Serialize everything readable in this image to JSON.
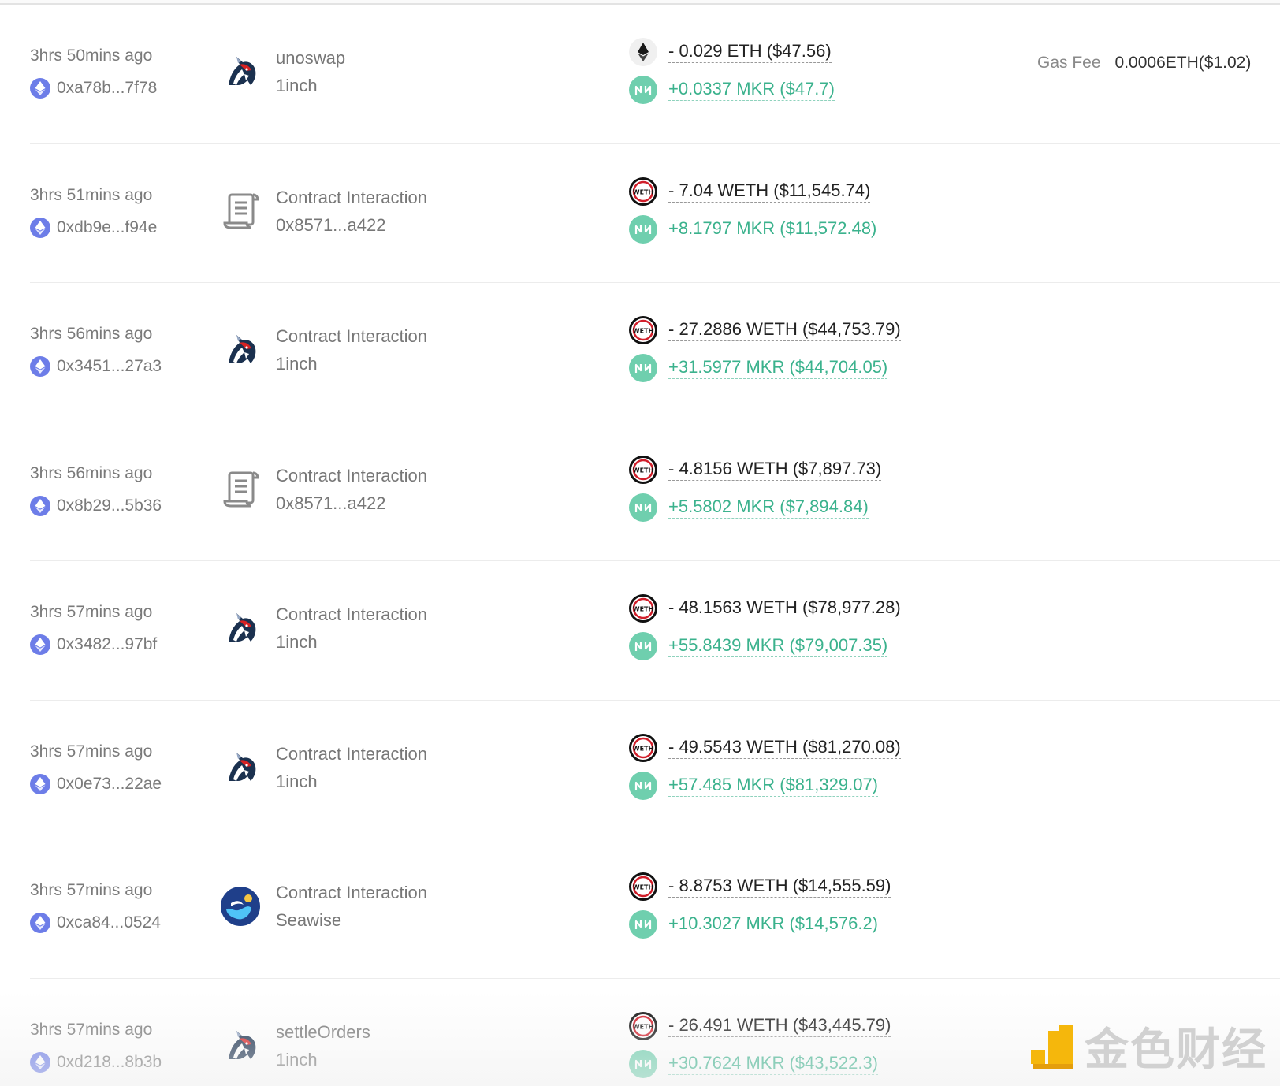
{
  "gas": {
    "label": "Gas Fee",
    "value": "0.0006ETH($1.02)"
  },
  "icons": {
    "address": "ethereum-icon",
    "oneinch": "1inch-unicorn-icon",
    "contract": "contract-scroll-icon",
    "seawise": "seawise-icon",
    "eth": "eth-token-icon",
    "weth": "weth-token-icon",
    "mkr": "mkr-token-icon"
  },
  "colors": {
    "in": "#3bb28d",
    "out": "#222222",
    "mkr": "#6fcfae",
    "eth_badge": "#6d7de8"
  },
  "rows": [
    {
      "time": "3hrs 50mins ago",
      "address": "0xa78b...7f78",
      "icon": "oneinch",
      "method": "unoswap",
      "sub": "1inch",
      "out_token": "eth",
      "out": "- 0.029 ETH ($47.56)",
      "in": "+0.0337 MKR ($47.7)",
      "gas": true
    },
    {
      "time": "3hrs 51mins ago",
      "address": "0xdb9e...f94e",
      "icon": "contract",
      "method": "Contract Interaction",
      "sub": "0x8571...a422",
      "out_token": "weth",
      "out": "- 7.04 WETH ($11,545.74)",
      "in": "+8.1797 MKR ($11,572.48)",
      "gas": false
    },
    {
      "time": "3hrs 56mins ago",
      "address": "0x3451...27a3",
      "icon": "oneinch",
      "method": "Contract Interaction",
      "sub": "1inch",
      "out_token": "weth",
      "out": "- 27.2886 WETH ($44,753.79)",
      "in": "+31.5977 MKR ($44,704.05)",
      "gas": false
    },
    {
      "time": "3hrs 56mins ago",
      "address": "0x8b29...5b36",
      "icon": "contract",
      "method": "Contract Interaction",
      "sub": "0x8571...a422",
      "out_token": "weth",
      "out": "- 4.8156 WETH ($7,897.73)",
      "in": "+5.5802 MKR ($7,894.84)",
      "gas": false
    },
    {
      "time": "3hrs 57mins ago",
      "address": "0x3482...97bf",
      "icon": "oneinch",
      "method": "Contract Interaction",
      "sub": "1inch",
      "out_token": "weth",
      "out": "- 48.1563 WETH ($78,977.28)",
      "in": "+55.8439 MKR ($79,007.35)",
      "gas": false
    },
    {
      "time": "3hrs 57mins ago",
      "address": "0x0e73...22ae",
      "icon": "oneinch",
      "method": "Contract Interaction",
      "sub": "1inch",
      "out_token": "weth",
      "out": "- 49.5543 WETH ($81,270.08)",
      "in": "+57.485 MKR ($81,329.07)",
      "gas": false
    },
    {
      "time": "3hrs 57mins ago",
      "address": "0xca84...0524",
      "icon": "seawise",
      "method": "Contract Interaction",
      "sub": "Seawise",
      "out_token": "weth",
      "out": "- 8.8753 WETH ($14,555.59)",
      "in": "+10.3027 MKR ($14,576.2)",
      "gas": false
    },
    {
      "time": "3hrs 57mins ago",
      "address": "0xd218...8b3b",
      "icon": "oneinch",
      "method": "settleOrders",
      "sub": "1inch",
      "out_token": "weth",
      "out": "- 26.491 WETH ($43,445.79)",
      "in": "+30.7624 MKR ($43,522.3)",
      "gas": false
    }
  ],
  "watermark": {
    "text": "金色财经"
  }
}
